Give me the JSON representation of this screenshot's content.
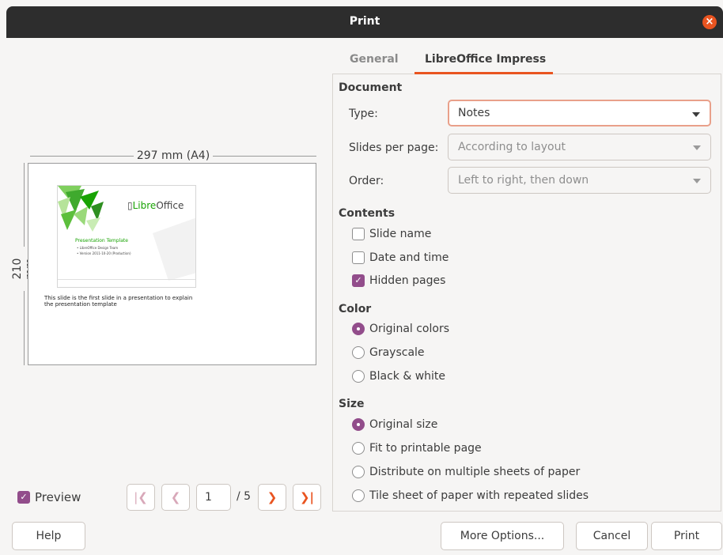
{
  "window": {
    "title": "Print"
  },
  "preview": {
    "width_label": "297 mm (A4)",
    "height_label": "210 mm",
    "slide": {
      "logo_prefix": "Libre",
      "logo_suffix": "Office",
      "title": "Presentation Template",
      "bullet1": "• LibreOffice Design Team",
      "bullet2": "• Version 2011-10-20 (Production)"
    },
    "notes": "This slide is the first slide in a presentation to explain the presentation template",
    "preview_label": "Preview",
    "preview_checked": true,
    "current_page": "1",
    "total_pages": "/ 5"
  },
  "tabs": [
    "General",
    "LibreOffice Impress"
  ],
  "active_tab": "LibreOffice Impress",
  "document": {
    "heading": "Document",
    "type_label": "Type:",
    "type_value": "Notes",
    "slides_per_page_label": "Slides per page:",
    "slides_per_page_value": "According to layout",
    "order_label": "Order:",
    "order_value": "Left to right, then down"
  },
  "contents": {
    "heading": "Contents",
    "items": [
      {
        "label": "Slide name",
        "checked": false
      },
      {
        "label": "Date and time",
        "checked": false
      },
      {
        "label": "Hidden pages",
        "checked": true
      }
    ]
  },
  "color": {
    "heading": "Color",
    "options": [
      "Original colors",
      "Grayscale",
      "Black & white"
    ],
    "selected": "Original colors"
  },
  "size": {
    "heading": "Size",
    "options": [
      "Original size",
      "Fit to printable page",
      "Distribute on multiple sheets of paper",
      "Tile sheet of paper with repeated slides"
    ],
    "selected": "Original size"
  },
  "buttons": {
    "help": "Help",
    "more_options": "More Options...",
    "cancel": "Cancel",
    "print": "Print"
  },
  "colors": {
    "accent": "#e95420",
    "check": "#924d8b",
    "titlebar": "#2d2d2d"
  }
}
